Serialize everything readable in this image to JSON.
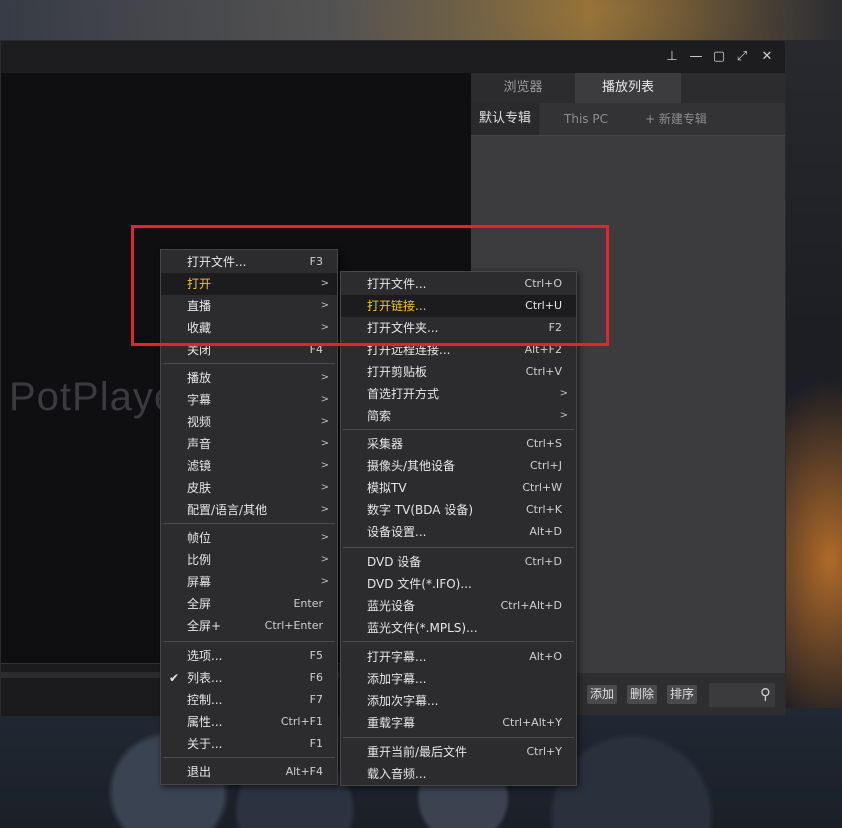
{
  "panel": {
    "tabs": [
      "浏览器",
      "播放列表"
    ],
    "subtabs": [
      "默认专辑",
      "This PC",
      "+ 新建专辑"
    ],
    "buttons": [
      "添加",
      "删除",
      "排序"
    ]
  },
  "logo_text": "PotPlayer",
  "main_menu": [
    {
      "label": "打开文件...",
      "shortcut": "F3"
    },
    {
      "label": "打开",
      "submenu": ">"
    },
    {
      "label": "直播",
      "submenu": ">"
    },
    {
      "label": "收藏",
      "submenu": ">"
    },
    {
      "label": "关闭",
      "shortcut": "F4"
    },
    {
      "label": "播放",
      "submenu": ">"
    },
    {
      "label": "字幕",
      "submenu": ">"
    },
    {
      "label": "视频",
      "submenu": ">"
    },
    {
      "label": "声音",
      "submenu": ">"
    },
    {
      "label": "滤镜",
      "submenu": ">"
    },
    {
      "label": "皮肤",
      "submenu": ">"
    },
    {
      "label": "配置/语言/其他",
      "submenu": ">"
    },
    {
      "label": "帧位",
      "submenu": ">"
    },
    {
      "label": "比例",
      "submenu": ">"
    },
    {
      "label": "屏幕",
      "submenu": ">"
    },
    {
      "label": "全屏",
      "shortcut": "Enter"
    },
    {
      "label": "全屏+",
      "shortcut": "Ctrl+Enter"
    },
    {
      "label": "选项...",
      "shortcut": "F5"
    },
    {
      "label": "列表...",
      "shortcut": "F6",
      "checked": "✔"
    },
    {
      "label": "控制...",
      "shortcut": "F7"
    },
    {
      "label": "属性...",
      "shortcut": "Ctrl+F1"
    },
    {
      "label": "关于...",
      "shortcut": "F1"
    },
    {
      "label": "退出",
      "shortcut": "Alt+F4"
    }
  ],
  "sub_menu": [
    {
      "label": "打开文件...",
      "shortcut": "Ctrl+O"
    },
    {
      "label": "打开链接...",
      "shortcut": "Ctrl+U"
    },
    {
      "label": "打开文件夹...",
      "shortcut": "F2"
    },
    {
      "label": "打开远程连接...",
      "shortcut": "Alt+F2"
    },
    {
      "label": "打开剪贴板",
      "shortcut": "Ctrl+V"
    },
    {
      "label": "首选打开方式",
      "submenu": ">"
    },
    {
      "label": "简索",
      "submenu": ">"
    },
    {
      "label": "采集器",
      "shortcut": "Ctrl+S"
    },
    {
      "label": "摄像头/其他设备",
      "shortcut": "Ctrl+J"
    },
    {
      "label": "模拟TV",
      "shortcut": "Ctrl+W"
    },
    {
      "label": "数字 TV(BDA 设备)",
      "shortcut": "Ctrl+K"
    },
    {
      "label": "设备设置...",
      "shortcut": "Alt+D"
    },
    {
      "label": "DVD 设备",
      "shortcut": "Ctrl+D"
    },
    {
      "label": "DVD 文件(*.IFO)..."
    },
    {
      "label": "蓝光设备",
      "shortcut": "Ctrl+Alt+D"
    },
    {
      "label": "蓝光文件(*.MPLS)..."
    },
    {
      "label": "打开字幕...",
      "shortcut": "Alt+O"
    },
    {
      "label": "添加字幕..."
    },
    {
      "label": "添加次字幕..."
    },
    {
      "label": "重载字幕",
      "shortcut": "Ctrl+Alt+Y"
    },
    {
      "label": "重开当前/最后文件",
      "shortcut": "Ctrl+Y"
    },
    {
      "label": "载入音频..."
    }
  ],
  "colors": {
    "highlight_text": "#f3c52e",
    "annotation_box": "#e0262c"
  }
}
